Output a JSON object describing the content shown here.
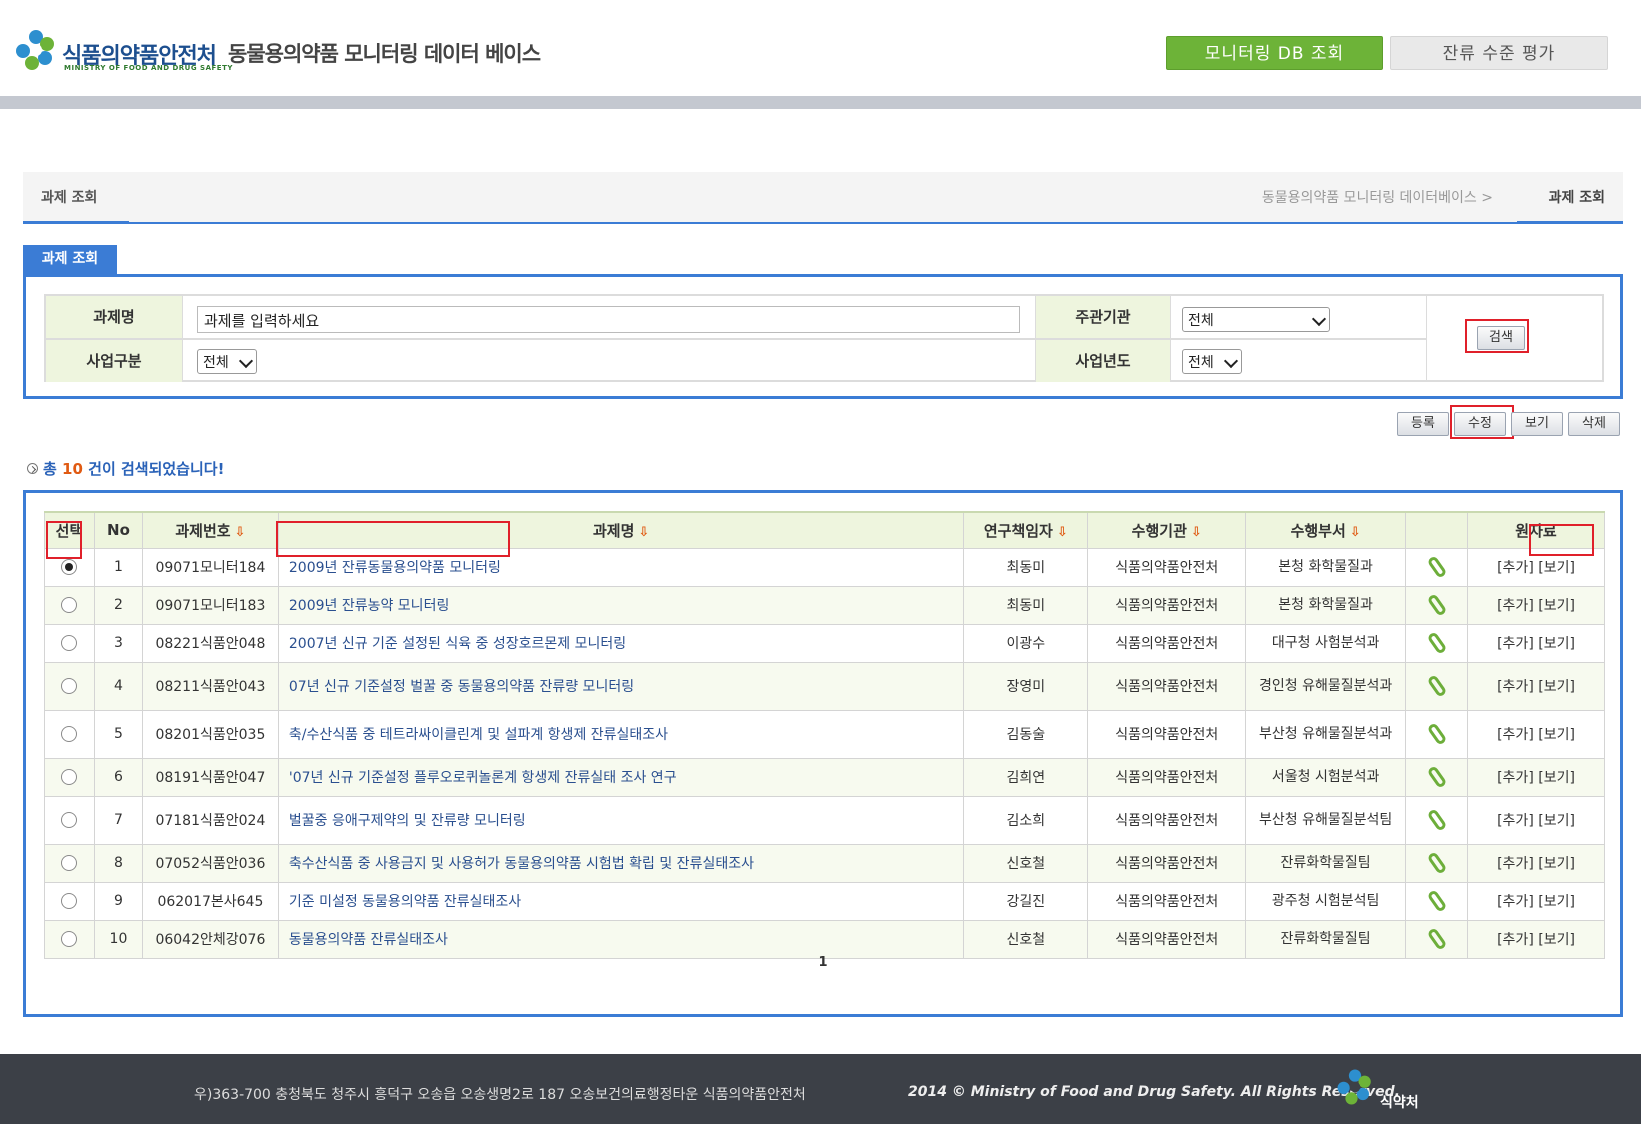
{
  "header": {
    "brand": "식품의약품안전처",
    "brand_en": "MINISTRY OF FOOD AND DRUG SAFETY",
    "site_title": "동물용의약품 모니터링 데이터 베이스",
    "nav": [
      {
        "label": "모니터링 DB 조회",
        "active": true
      },
      {
        "label": "잔류 수준 평가",
        "active": false
      }
    ]
  },
  "breadcrumb": {
    "title": "과제 조회",
    "path": "동물용의약품 모니터링 데이터베이스 >",
    "current": "과제 조회"
  },
  "search": {
    "section_title": "과제 조회",
    "fields": {
      "project_name_label": "과제명",
      "project_name_value": "과제를 입력하세요",
      "agency_label": "주관기관",
      "agency_value": "전체",
      "business_label": "사업구분",
      "business_value": "전체",
      "year_label": "사업년도",
      "year_value": "전체"
    },
    "search_button": "검색"
  },
  "actions": {
    "register": "등록",
    "edit": "수정",
    "view": "보기",
    "delete": "삭제"
  },
  "result": {
    "prefix": "총",
    "count": "10",
    "suffix": "건이 검색되었습니다!"
  },
  "table": {
    "columns": [
      "선택",
      "No",
      "과제번호",
      "과제명",
      "연구책임자",
      "수행기관",
      "수행부서",
      "",
      "원자료"
    ],
    "add_label": "[추가]",
    "view_label": "[보기]",
    "rows": [
      {
        "selected": true,
        "no": "1",
        "code": "09071모니터184",
        "title": "2009년 잔류동물용의약품 모니터링",
        "researcher": "최동미",
        "agency": "식품의약품안전처",
        "dept": "본청 화학물질과"
      },
      {
        "selected": false,
        "no": "2",
        "code": "09071모니터183",
        "title": "2009년 잔류농약 모니터링",
        "researcher": "최동미",
        "agency": "식품의약품안전처",
        "dept": "본청 화학물질과"
      },
      {
        "selected": false,
        "no": "3",
        "code": "08221식품안048",
        "title": "2007년 신규 기준 설정된 식육 중 성장호르몬제 모니터링",
        "researcher": "이광수",
        "agency": "식품의약품안전처",
        "dept": "대구청 사험분석과"
      },
      {
        "selected": false,
        "no": "4",
        "code": "08211식품안043",
        "title": "07년 신규 기준설정 벌꿀 중 동물용의약품 잔류량 모니터링",
        "researcher": "장영미",
        "agency": "식품의약품안전처",
        "dept": "경인청 유해물질분석과"
      },
      {
        "selected": false,
        "no": "5",
        "code": "08201식품안035",
        "title": "축/수산식품 중 테트라싸이클린계 및 설파계 항생제 잔류실태조사",
        "researcher": "김동술",
        "agency": "식품의약품안전처",
        "dept": "부산청 유해물질분석과"
      },
      {
        "selected": false,
        "no": "6",
        "code": "08191식품안047",
        "title": "'07년 신규 기준설정 플루오로퀴놀론계 항생제 잔류실태 조사 연구",
        "researcher": "김희연",
        "agency": "식품의약품안전처",
        "dept": "서울청 시험분석과"
      },
      {
        "selected": false,
        "no": "7",
        "code": "07181식품안024",
        "title": "벌꿀중 응애구제약의 및 잔류량 모니터링",
        "researcher": "김소희",
        "agency": "식품의약품안전처",
        "dept": "부산청 유해물질분석팀"
      },
      {
        "selected": false,
        "no": "8",
        "code": "07052식품안036",
        "title": "축수산식품 중 사용금지 및 사용허가 동물용의약품 시험법 확립 및 잔류실태조사",
        "researcher": "신호철",
        "agency": "식품의약품안전처",
        "dept": "잔류화학물질팀"
      },
      {
        "selected": false,
        "no": "9",
        "code": "062017본사645",
        "title": "기준 미설정 동물용의약품 잔류실태조사",
        "researcher": "강길진",
        "agency": "식품의약품안전처",
        "dept": "광주청 시험분석팀"
      },
      {
        "selected": false,
        "no": "10",
        "code": "06042안체강076",
        "title": "동물용의약품 잔류실태조사",
        "researcher": "신호철",
        "agency": "식품의약품안전처",
        "dept": "잔류화학물질팀"
      }
    ]
  },
  "pagination": {
    "current": "1"
  },
  "footer": {
    "address": "우)363-700 충청북도 청주시 흥덕구 오송읍 오송생명2로 187 오송보건의료행정타운 식품의약품안전처",
    "copyright": "2014 © Ministry of Food and Drug Safety. All Rights Reserved.",
    "brand": "식약처"
  },
  "icons": [
    "logo-icon",
    "dropdown-chevron-icon",
    "radio-icon",
    "attachment-clip-icon",
    "sort-arrow-icon",
    "arrow-circle-icon"
  ],
  "colors": {
    "accent_blue": "#3b7cd5",
    "active_green": "#6db338",
    "highlight_red": "#e0202a",
    "count_orange": "#e05a12"
  }
}
